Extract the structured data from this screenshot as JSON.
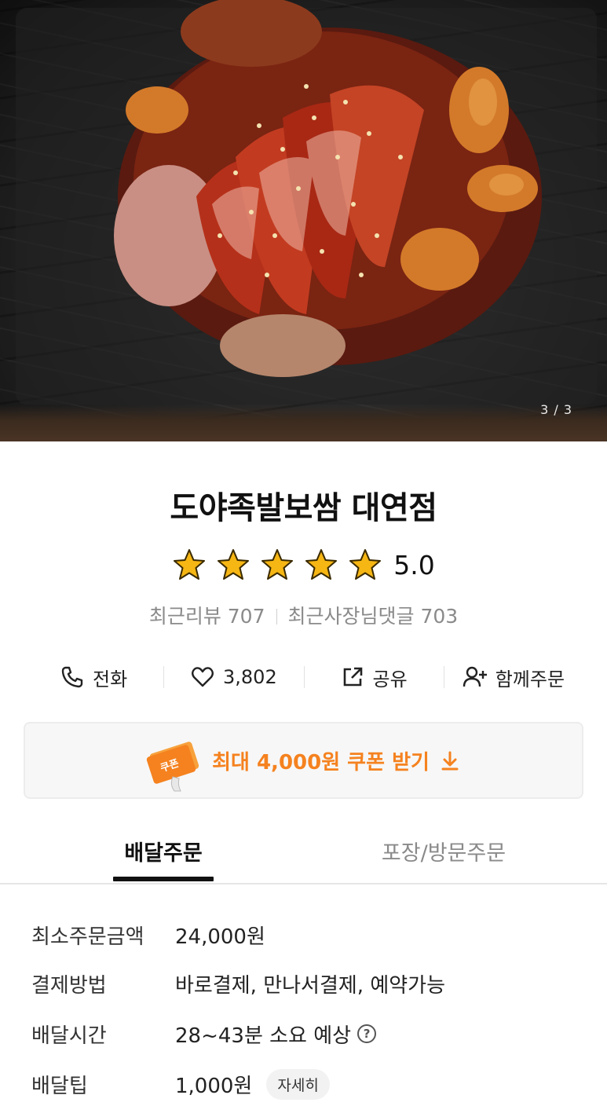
{
  "hero": {
    "counter": "3 / 3"
  },
  "store": {
    "name": "도야족발보쌈 대연점",
    "rating": 5.0,
    "score_text": "5.0",
    "star_color": "#f6b613",
    "recent_reviews": "최근리뷰 707",
    "owner_replies": "최근사장님댓글 703"
  },
  "actions": {
    "call_label": "전화",
    "like_count": "3,802",
    "share_label": "공유",
    "group_order_label": "함께주문"
  },
  "coupon": {
    "icon_text": "쿠폰",
    "label": "최대 4,000원 쿠폰 받기",
    "accent_color": "#f5821f"
  },
  "tabs": {
    "delivery": "배달주문",
    "pickup": "포장/방문주문"
  },
  "info": {
    "min_order_label": "최소주문금액",
    "min_order_value": "24,000원",
    "payment_label": "결제방법",
    "payment_value": "바로결제, 만나서결제, 예약가능",
    "time_label": "배달시간",
    "time_value": "28~43분 소요 예상",
    "tip_label": "배달팁",
    "tip_value": "1,000원",
    "tip_detail": "자세히"
  }
}
